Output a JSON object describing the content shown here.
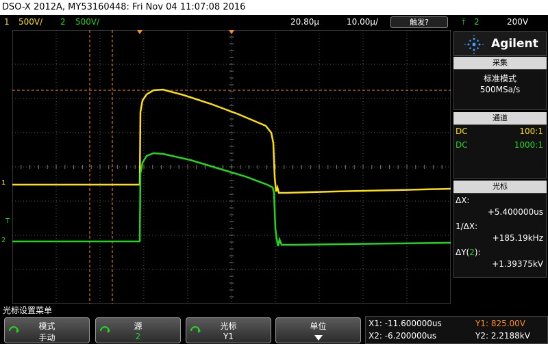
{
  "title_bar": "DSO-X 2012A, MY53160448: Fri Nov 04 11:07:08 2016",
  "status": {
    "ch1_num": "1",
    "ch1_scale": "500V/",
    "ch2_num": "2",
    "ch2_scale": "500V/",
    "time_position": "20.80µ",
    "time_scale": "10.00µ/",
    "trigger_button": "触发?",
    "trigger_source": "2",
    "trigger_level": "200V"
  },
  "panel": {
    "brand": "Agilent",
    "acquire_header": "采集",
    "acquire_mode": "标准模式",
    "sample_rate": "500MSa/s",
    "channel_header": "通道",
    "ch1_coupling": "DC",
    "ch1_probe": "100:1",
    "ch2_coupling": "DC",
    "ch2_probe": "1000:1",
    "cursor_header": "光标",
    "delta_x_label": "ΔX:",
    "delta_x_value": "+5.400000us",
    "inv_delta_x_label": "1/ΔX:",
    "inv_delta_x_value": "+185.19kHz",
    "delta_y_label_pre": "ΔY(",
    "delta_y_label_ch": "2",
    "delta_y_label_post": "):",
    "delta_y_value": "+1.39375kV"
  },
  "markers": {
    "ch1": "1",
    "ch2": "2",
    "trig": "T"
  },
  "menu_title": "光标设置菜单",
  "softkeys": [
    {
      "top": "模式",
      "bottom": "手动"
    },
    {
      "top": "源",
      "bottom": "2"
    },
    {
      "top": "光标",
      "bottom": "Y1"
    },
    {
      "top": "单位",
      "bottom": ""
    }
  ],
  "cursor_readout": {
    "x1": "X1: -11.600000us",
    "x2": "X2: -6.200000us",
    "y1": "Y1: 825.00V",
    "y2": "Y2: 2.2188kV"
  },
  "colors": {
    "ch1": "#ffe100",
    "ch2": "#22d61e",
    "cursor": "#ff8c1a",
    "grid": "#555555"
  }
}
